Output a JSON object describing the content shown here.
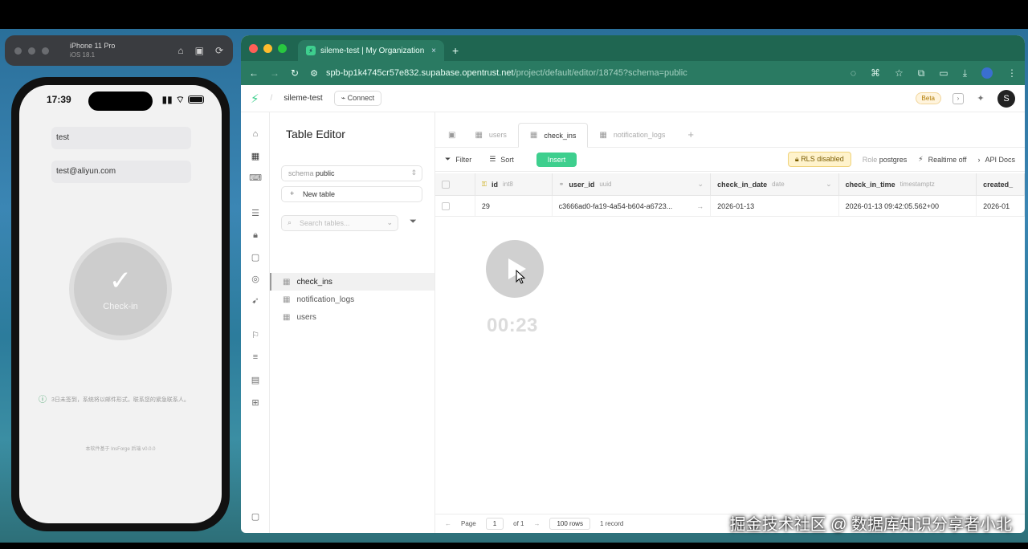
{
  "simulator": {
    "device": "iPhone 11 Pro",
    "os": "iOS 18.1",
    "phone": {
      "time": "17:39",
      "name_value": "test",
      "email_value": "test@aliyun.com",
      "checkin_label": "Check-in",
      "notice": "3日未签到，系统将以邮件形式，联系您的紧急联系人。",
      "footer": "本软件基于 InsForge 后端 v0.0.0"
    }
  },
  "browser": {
    "tab_title": "sileme-test | My Organization",
    "url_host": "spb-bp1k4745cr57e832.supabase.opentrust.net",
    "url_path": "/project/default/editor/18745?schema=public"
  },
  "app": {
    "project": "sileme-test",
    "connect": "Connect",
    "beta": "Beta",
    "avatar_initial": "S"
  },
  "table_editor": {
    "title": "Table Editor",
    "schema_label": "schema",
    "schema_value": "public",
    "new_table": "New table",
    "search_placeholder": "Search tables...",
    "tables": [
      "check_ins",
      "notification_logs",
      "users"
    ]
  },
  "tabs": [
    "users",
    "check_ins",
    "notification_logs"
  ],
  "toolbar": {
    "filter": "Filter",
    "sort": "Sort",
    "insert": "Insert",
    "rls": "RLS disabled",
    "role_label": "Role",
    "role_value": "postgres",
    "realtime": "Realtime off",
    "api_docs": "API Docs"
  },
  "grid": {
    "columns": [
      {
        "name": "id",
        "type": "int8"
      },
      {
        "name": "user_id",
        "type": "uuid"
      },
      {
        "name": "check_in_date",
        "type": "date"
      },
      {
        "name": "check_in_time",
        "type": "timestamptz"
      },
      {
        "name": "created_",
        "type": ""
      }
    ],
    "rows": [
      [
        "29",
        "c3666ad0-fa19-4a54-b604-a6723...",
        "2026-01-13",
        "2026-01-13 09:42:05.562+00",
        "2026-01"
      ]
    ]
  },
  "pager": {
    "page_label": "Page",
    "page_value": "1",
    "of": "of 1",
    "rows": "100 rows",
    "records": "1 record"
  },
  "video": {
    "timer": "00:23"
  },
  "watermark": "掘金技术社区 @ 数据库知识分享者小北"
}
